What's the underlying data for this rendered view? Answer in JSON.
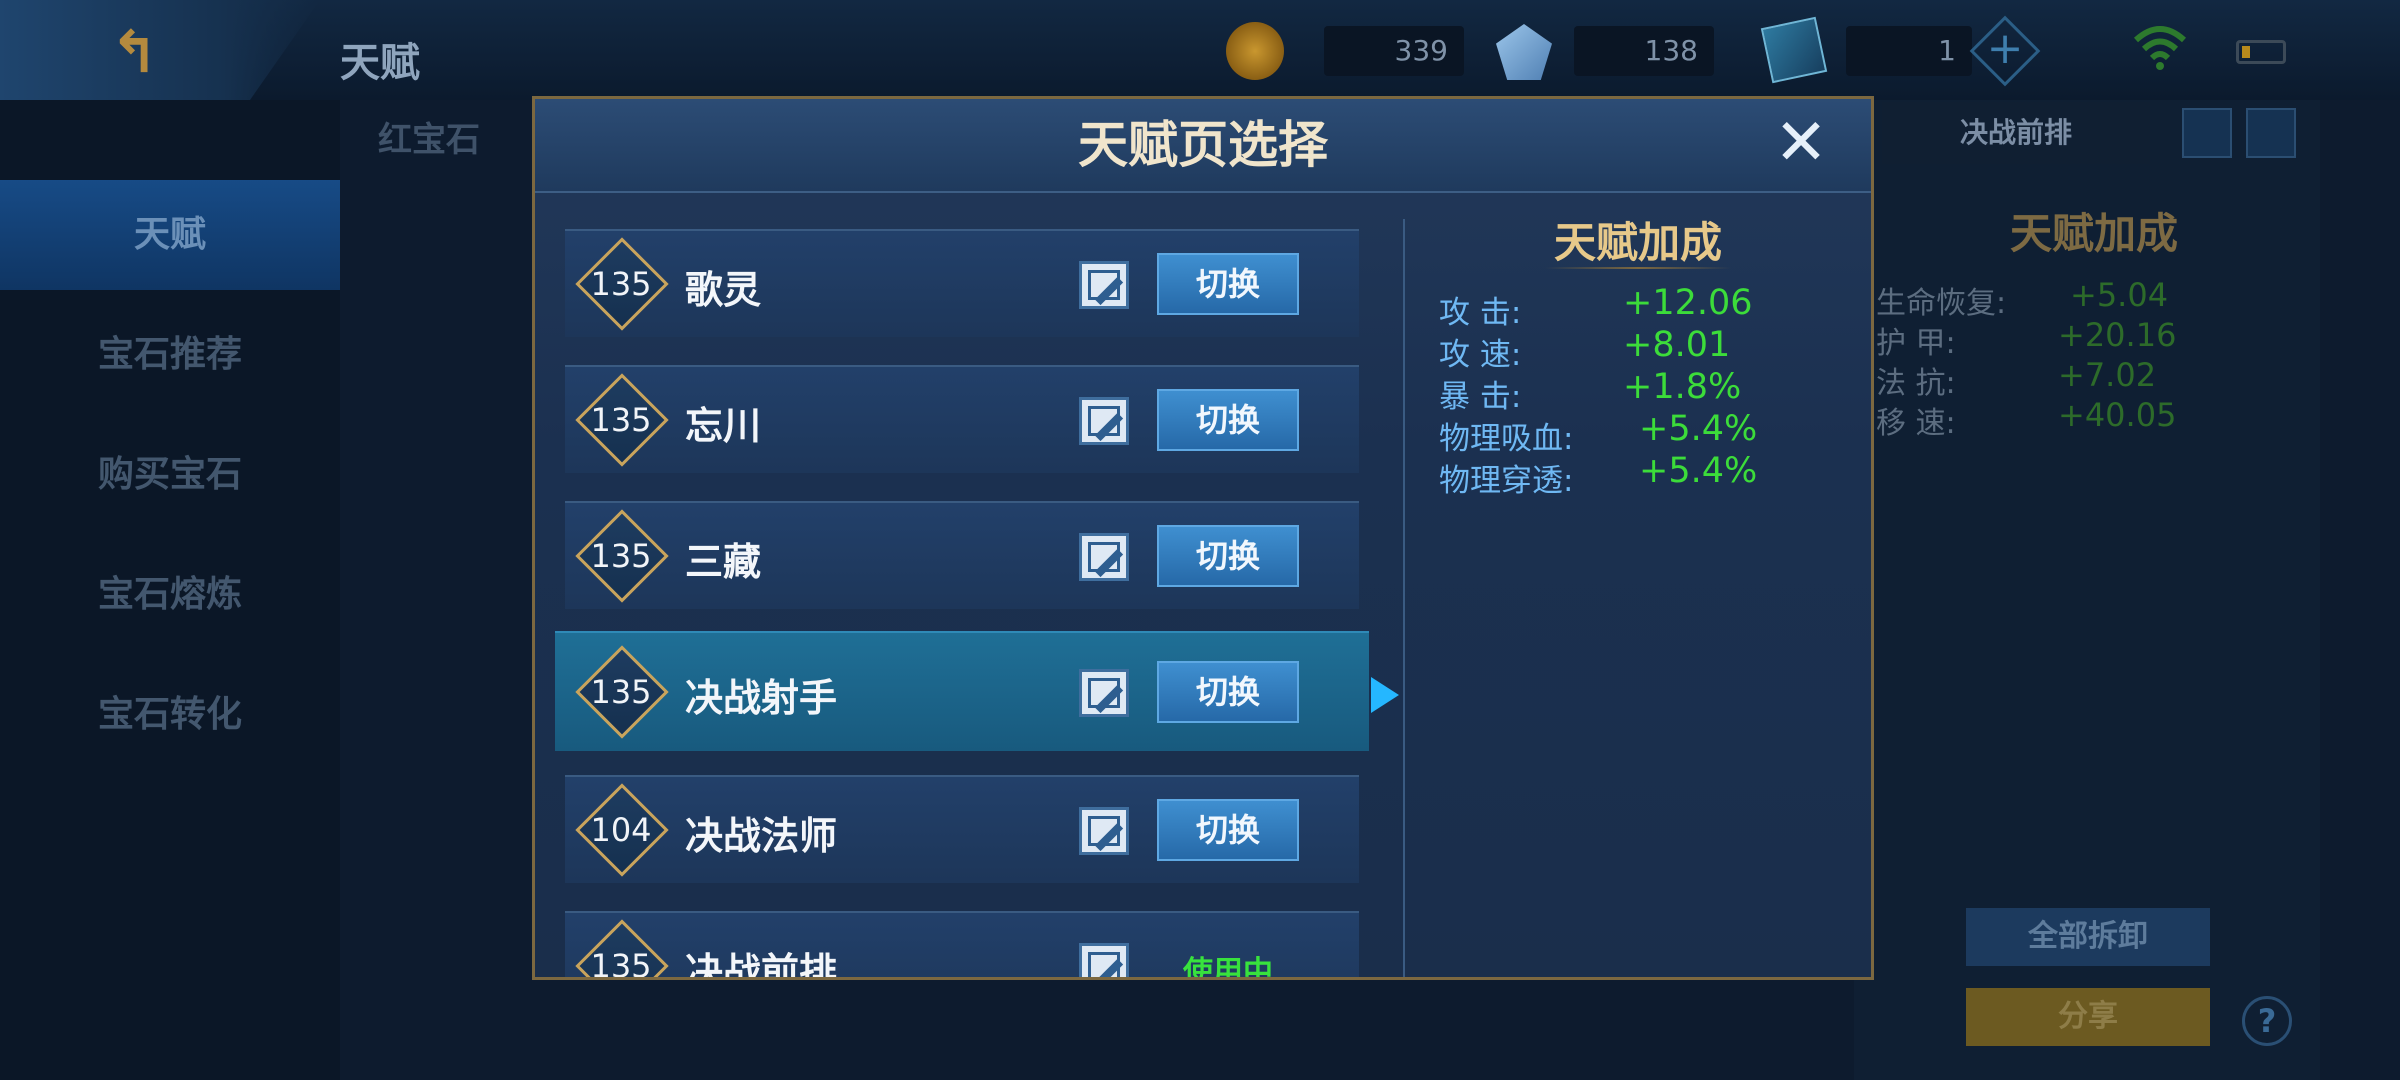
{
  "header": {
    "back_icon": "back-arrow-icon",
    "title": "天赋",
    "resources": [
      {
        "icon": "gold-coin-icon",
        "value": "339"
      },
      {
        "icon": "diamond-icon",
        "value": "138"
      },
      {
        "icon": "gem-ticket-icon",
        "value": "1"
      }
    ],
    "add_icon": "plus-icon"
  },
  "sidebar": {
    "items": [
      {
        "label": "天赋"
      },
      {
        "label": "宝石推荐"
      },
      {
        "label": "购买宝石"
      },
      {
        "label": "宝石熔炼"
      },
      {
        "label": "宝石转化"
      }
    ]
  },
  "background": {
    "tab_label": "红宝石",
    "current_page": "决战前排",
    "bonus_title": "天赋加成",
    "stats": [
      {
        "label": "生命恢复:",
        "value": "+5.04"
      },
      {
        "label": "护    甲:",
        "value": "+20.16"
      },
      {
        "label": "法    抗:",
        "value": "+7.02"
      },
      {
        "label": "移    速:",
        "value": "+40.05"
      }
    ],
    "unload_all": "全部拆卸",
    "share": "分享",
    "help": "?"
  },
  "modal": {
    "title": "天赋页选择",
    "close_icon": "close-icon",
    "pages": [
      {
        "level": "135",
        "name": "歌灵",
        "action": "切换"
      },
      {
        "level": "135",
        "name": "忘川",
        "action": "切换"
      },
      {
        "level": "135",
        "name": "三藏",
        "action": "切换"
      },
      {
        "level": "135",
        "name": "决战射手",
        "action": "切换"
      },
      {
        "level": "104",
        "name": "决战法师",
        "action": "切换"
      },
      {
        "level": "135",
        "name": "决战前排",
        "action": "使用中"
      }
    ],
    "selected_index": 3,
    "bonus": {
      "title": "天赋加成",
      "stats": [
        {
          "label": "攻    击:",
          "value": "+12.06"
        },
        {
          "label": "攻    速:",
          "value": "+8.01"
        },
        {
          "label": "暴    击:",
          "value": "+1.8%"
        },
        {
          "label": "物理吸血:",
          "value": "+5.4%"
        },
        {
          "label": "物理穿透:",
          "value": "+5.4%"
        }
      ]
    }
  }
}
